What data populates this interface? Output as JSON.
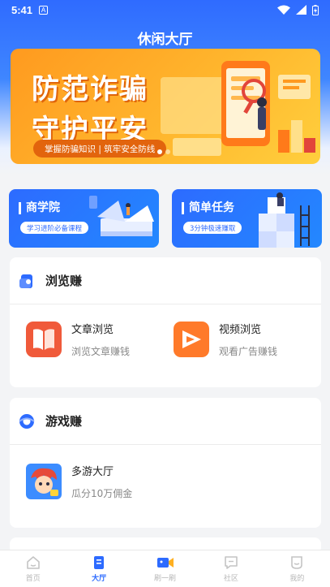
{
  "status_bar": {
    "time": "5:41",
    "notification_icon": "A"
  },
  "header": {
    "title": "休闲大厅"
  },
  "banner": {
    "line1": "防范诈骗",
    "line2": "守护平安",
    "tagline": "掌握防骗知识 | 筑牢安全防线"
  },
  "promos": [
    {
      "title": "商学院",
      "subtitle": "学习进阶必备课程"
    },
    {
      "title": "简单任务",
      "subtitle": "3分钟极速赚取"
    }
  ],
  "browse_section": {
    "title": "浏览赚",
    "items": [
      {
        "name": "文章浏览",
        "desc": "浏览文章赚钱"
      },
      {
        "name": "视频浏览",
        "desc": "观看广告赚钱"
      }
    ]
  },
  "game_section": {
    "title": "游戏赚",
    "items": [
      {
        "name": "多游大厅",
        "desc": "瓜分10万佣金"
      }
    ]
  },
  "bottom_nav": [
    {
      "label": "首页"
    },
    {
      "label": "大厅"
    },
    {
      "label": "刷一刷"
    },
    {
      "label": "社区"
    },
    {
      "label": "我的"
    }
  ],
  "colors": {
    "primary": "#2d6bff",
    "banner_orange": "#ffb02d"
  }
}
